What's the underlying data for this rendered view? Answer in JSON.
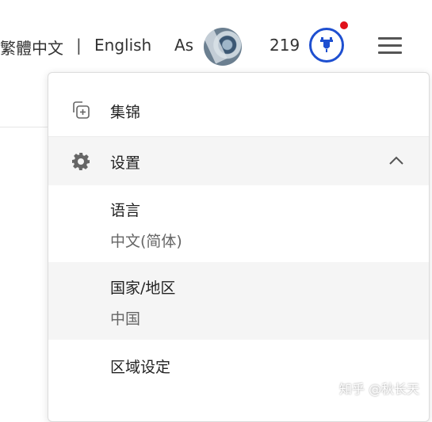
{
  "header": {
    "lang_traditional": "繁體中文",
    "lang_separator": "|",
    "lang_english": "English",
    "user_name": "As",
    "points": "219"
  },
  "menu": {
    "collections_label": "集锦",
    "settings_label": "设置",
    "language_label": "语言",
    "language_value": "中文(简体)",
    "region_label": "国家/地区",
    "region_value": "中国",
    "locale_label": "区域设定"
  },
  "watermark": "知乎 @秋长天",
  "colors": {
    "accent_blue": "#1e4fd0",
    "notification_red": "#e0101a",
    "highlight_bg": "#f5f5f5"
  }
}
